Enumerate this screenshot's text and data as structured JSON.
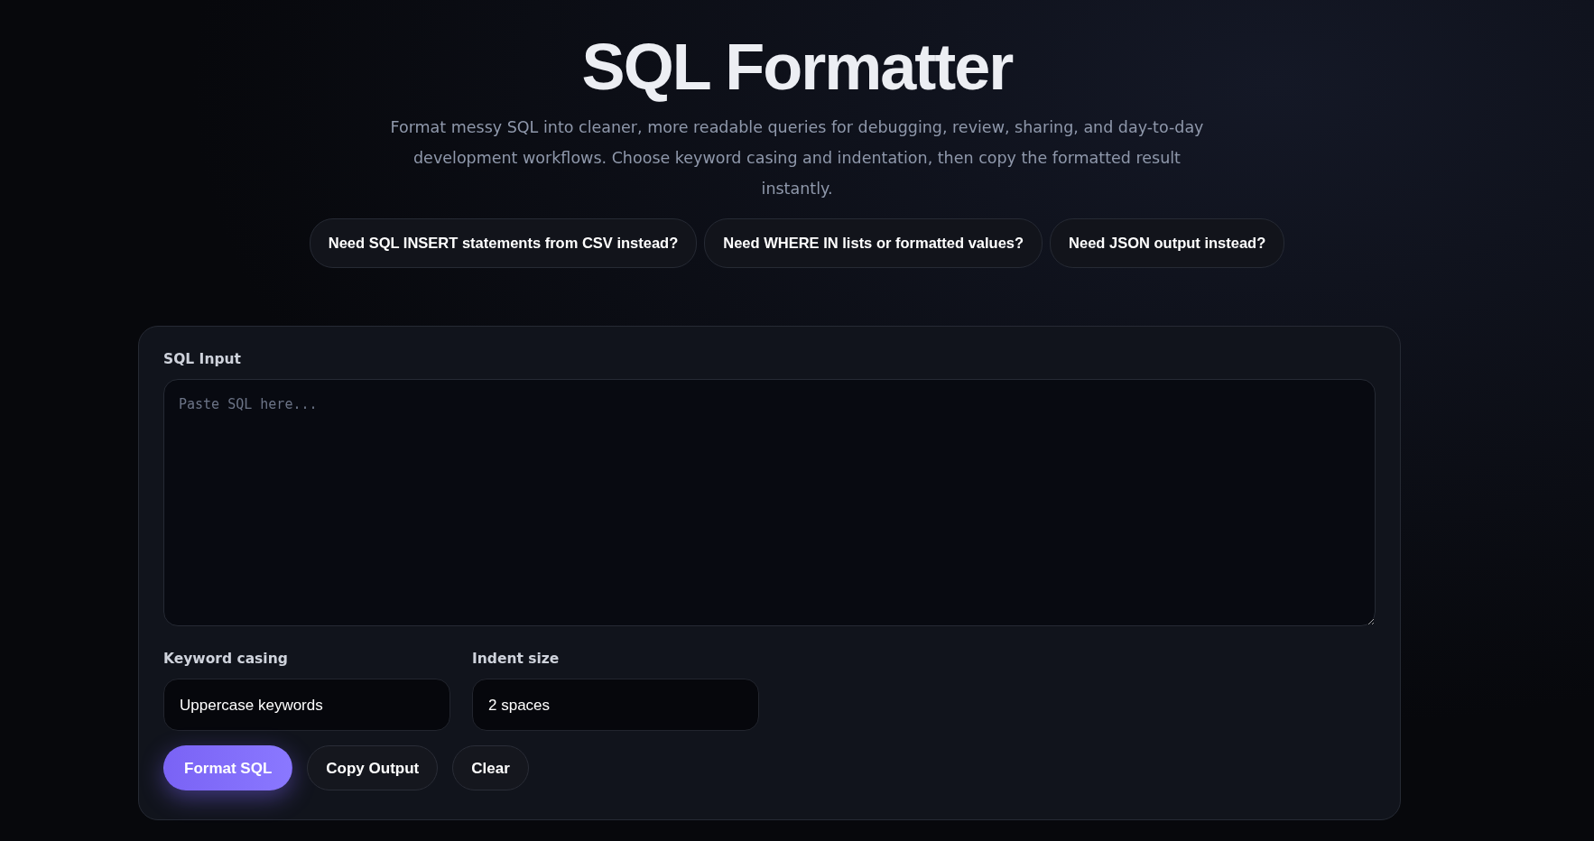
{
  "header": {
    "title": "SQL Formatter",
    "description": "Format messy SQL into cleaner, more readable queries for debugging, review, sharing, and day-to-day development workflows. Choose keyword casing and indentation, then copy the formatted result instantly."
  },
  "links": [
    "Need SQL INSERT statements from CSV instead?",
    "Need WHERE IN lists or formatted values?",
    "Need JSON output instead?"
  ],
  "input": {
    "label": "SQL Input",
    "placeholder": "Paste SQL here..."
  },
  "options": [
    {
      "label": "Keyword casing",
      "value": "Uppercase keywords"
    },
    {
      "label": "Indent size",
      "value": "2 spaces"
    }
  ],
  "buttons": [
    {
      "label": "Format SQL",
      "kind": "primary"
    },
    {
      "label": "Copy Output",
      "kind": "secondary"
    },
    {
      "label": "Clear",
      "kind": "secondary"
    }
  ]
}
